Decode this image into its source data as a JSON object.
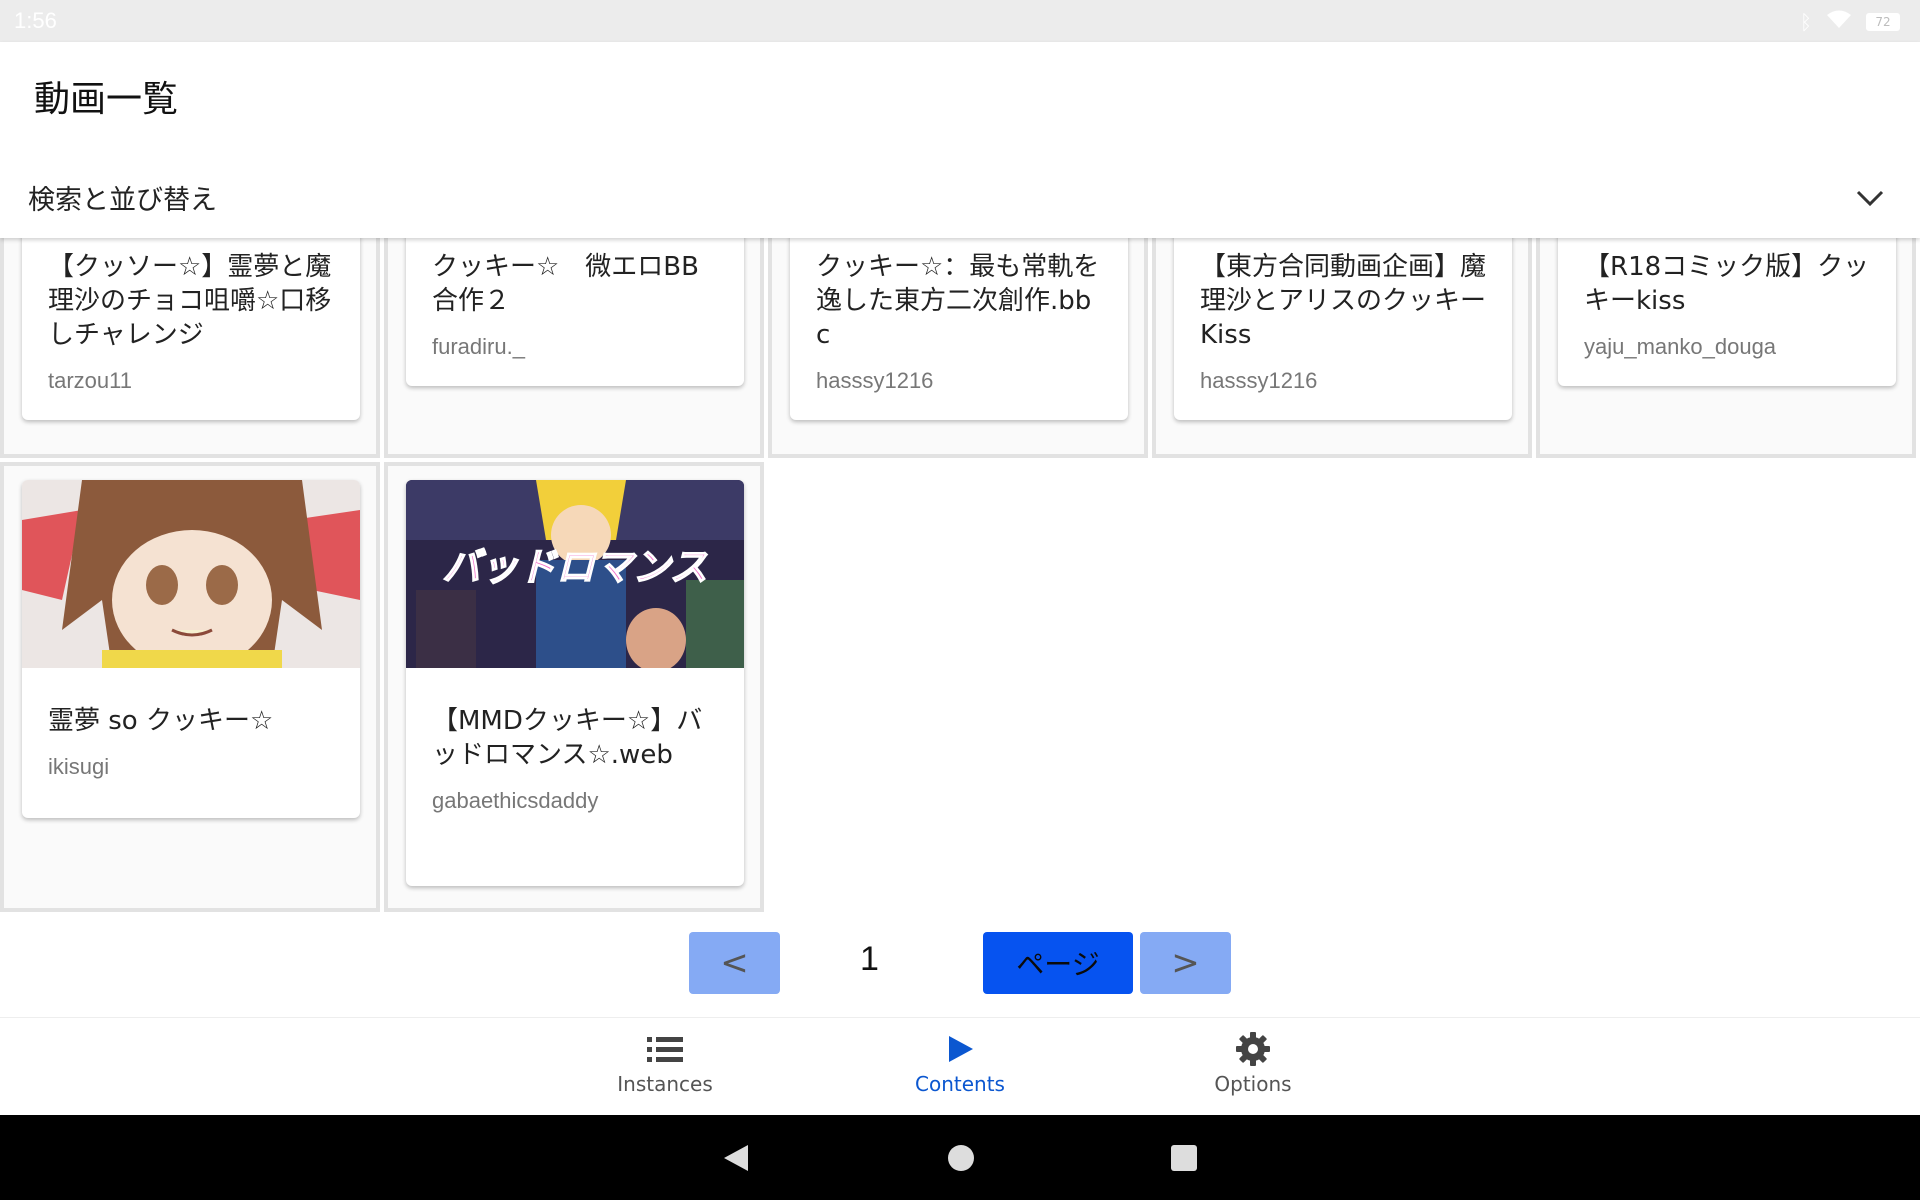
{
  "status_bar": {
    "time": "1:56",
    "battery": "72"
  },
  "header": {
    "title": "動画一覧",
    "search_sort_label": "検索と並び替え"
  },
  "videos": [
    {
      "title": "【クッソー☆】霊夢と魔理沙のチョコ咀嚼☆口移しチャレンジ",
      "author": "tarzou11"
    },
    {
      "title": "クッキー☆　微エロBB合作２",
      "author": "furadiru._"
    },
    {
      "title": "クッキー☆：最も常軌を逸した東方二次創作.bbc",
      "author": "hasssy1216"
    },
    {
      "title": "【東方合同動画企画】魔理沙とアリスのクッキーKiss",
      "author": "hasssy1216"
    },
    {
      "title": "【R18コミック版】クッキーkiss",
      "author": "yaju_manko_douga"
    },
    {
      "title": "霊夢 so クッキー☆",
      "author": "ikisugi"
    },
    {
      "title": "【MMDクッキー☆】バッドロマンス☆.web",
      "author": "gabaethicsdaddy"
    }
  ],
  "thumbnails": {
    "reimu_thumbnail_text": "",
    "bad_romance_thumbnail_text": "バッドロマンス"
  },
  "pagination": {
    "prev_label": "<",
    "page_number": "1",
    "go_label": "ページ",
    "next_label": ">"
  },
  "bottom_nav": {
    "instances": "Instances",
    "contents": "Contents",
    "options": "Options"
  },
  "colors": {
    "accent": "#0b57d0",
    "page_button": "#0653f0",
    "disabled_button": "#85aaf4"
  }
}
